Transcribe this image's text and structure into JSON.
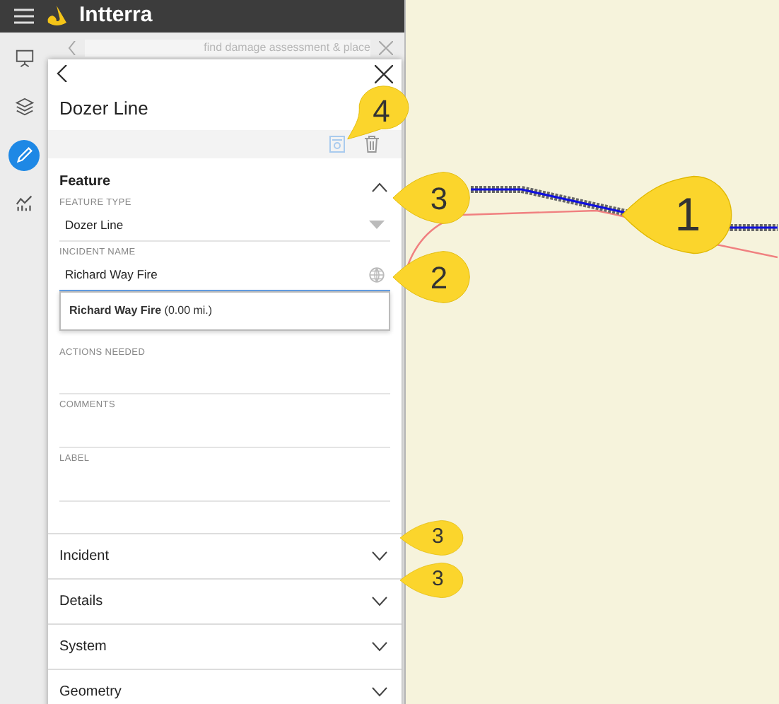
{
  "header": {
    "title": "Intterra"
  },
  "rail": [
    {
      "kind": "presentation",
      "selected": false
    },
    {
      "kind": "layers",
      "selected": false
    },
    {
      "kind": "draw",
      "selected": true
    },
    {
      "kind": "chart",
      "selected": false
    }
  ],
  "back_panel": {
    "placeholder": "find damage assessment & place"
  },
  "panel": {
    "title": "Dozer Line",
    "sections": [
      {
        "title": "Feature",
        "expanded": true,
        "fields": [
          {
            "kind": "select",
            "label": "FEATURE TYPE",
            "value": "Dozer Line",
            "focused": false
          },
          {
            "kind": "autocomplete",
            "label": "INCIDENT NAME",
            "value": "Richard Way Fire",
            "focused": true,
            "suggestions": [
              "**Richard Way Fire** (0.00 mi.)"
            ]
          },
          {
            "kind": "text",
            "label": "ACTIONS NEEDED",
            "focused": false
          },
          {
            "kind": "text",
            "label": "COMMENTS",
            "focused": false
          },
          {
            "kind": "text",
            "label": "LABEL",
            "focused": false
          }
        ]
      },
      {
        "title": "Incident",
        "expanded": false
      },
      {
        "title": "Details",
        "expanded": false
      },
      {
        "title": "System",
        "expanded": false
      },
      {
        "title": "Geometry",
        "expanded": false
      }
    ]
  },
  "callouts": [
    {
      "number": "4",
      "kind": "down-left"
    },
    {
      "number": "3",
      "kind": "left"
    },
    {
      "number": "1",
      "kind": "left"
    },
    {
      "number": "2",
      "kind": "left"
    },
    {
      "number": "3",
      "kind": "left"
    },
    {
      "number": "3",
      "kind": "left"
    }
  ]
}
